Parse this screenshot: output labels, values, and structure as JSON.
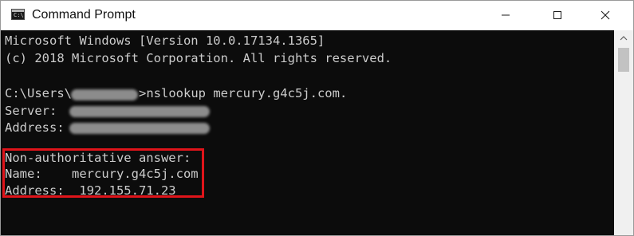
{
  "window": {
    "title": "Command Prompt",
    "icon": "cmd-icon",
    "controls": [
      "minimize-icon",
      "maximize-icon",
      "close-icon"
    ]
  },
  "console": {
    "lines": [
      "Microsoft Windows [Version 10.0.17134.1365]",
      "(c) 2018 Microsoft Corporation. All rights reserved.",
      "",
      "C:\\Users\\",
      "Server:",
      "Address:",
      "",
      "Non-authoritative answer:",
      "Name:    mercury.g4c5j.com",
      "Address:  192.155.71.23"
    ],
    "command": ">nslookup mercury.g4c5j.com."
  },
  "colors": {
    "console_bg": "#0c0c0c",
    "console_text": "#cccccc",
    "highlight_border": "#e0141a"
  }
}
